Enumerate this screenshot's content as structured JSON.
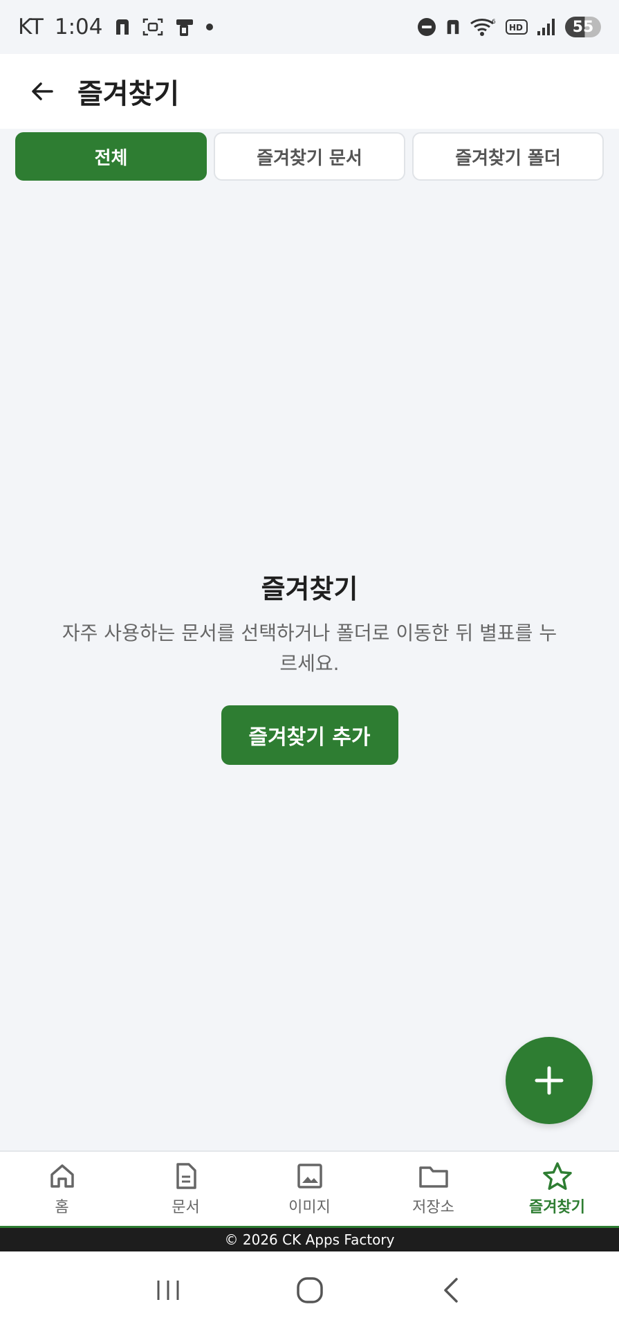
{
  "status_bar": {
    "carrier": "KT",
    "time": "1:04",
    "battery": "55"
  },
  "app_bar": {
    "title": "즐겨찾기"
  },
  "tabs": [
    {
      "label": "전체",
      "active": true
    },
    {
      "label": "즐겨찾기 문서",
      "active": false
    },
    {
      "label": "즐겨찾기 폴더",
      "active": false
    }
  ],
  "empty_state": {
    "title": "즐겨찾기",
    "description": "자주 사용하는 문서를 선택하거나 폴더로 이동한 뒤 별표를 누르세요.",
    "button_label": "즐겨찾기 추가"
  },
  "bottom_nav": [
    {
      "label": "홈",
      "icon": "home-icon",
      "active": false
    },
    {
      "label": "문서",
      "icon": "document-icon",
      "active": false
    },
    {
      "label": "이미지",
      "icon": "image-icon",
      "active": false
    },
    {
      "label": "저장소",
      "icon": "folder-icon",
      "active": false
    },
    {
      "label": "즐겨찾기",
      "icon": "star-icon",
      "active": true
    }
  ],
  "footer": {
    "text": "© 2026 CK Apps Factory"
  },
  "colors": {
    "accent": "#2e7d32",
    "background": "#f3f5f8"
  }
}
